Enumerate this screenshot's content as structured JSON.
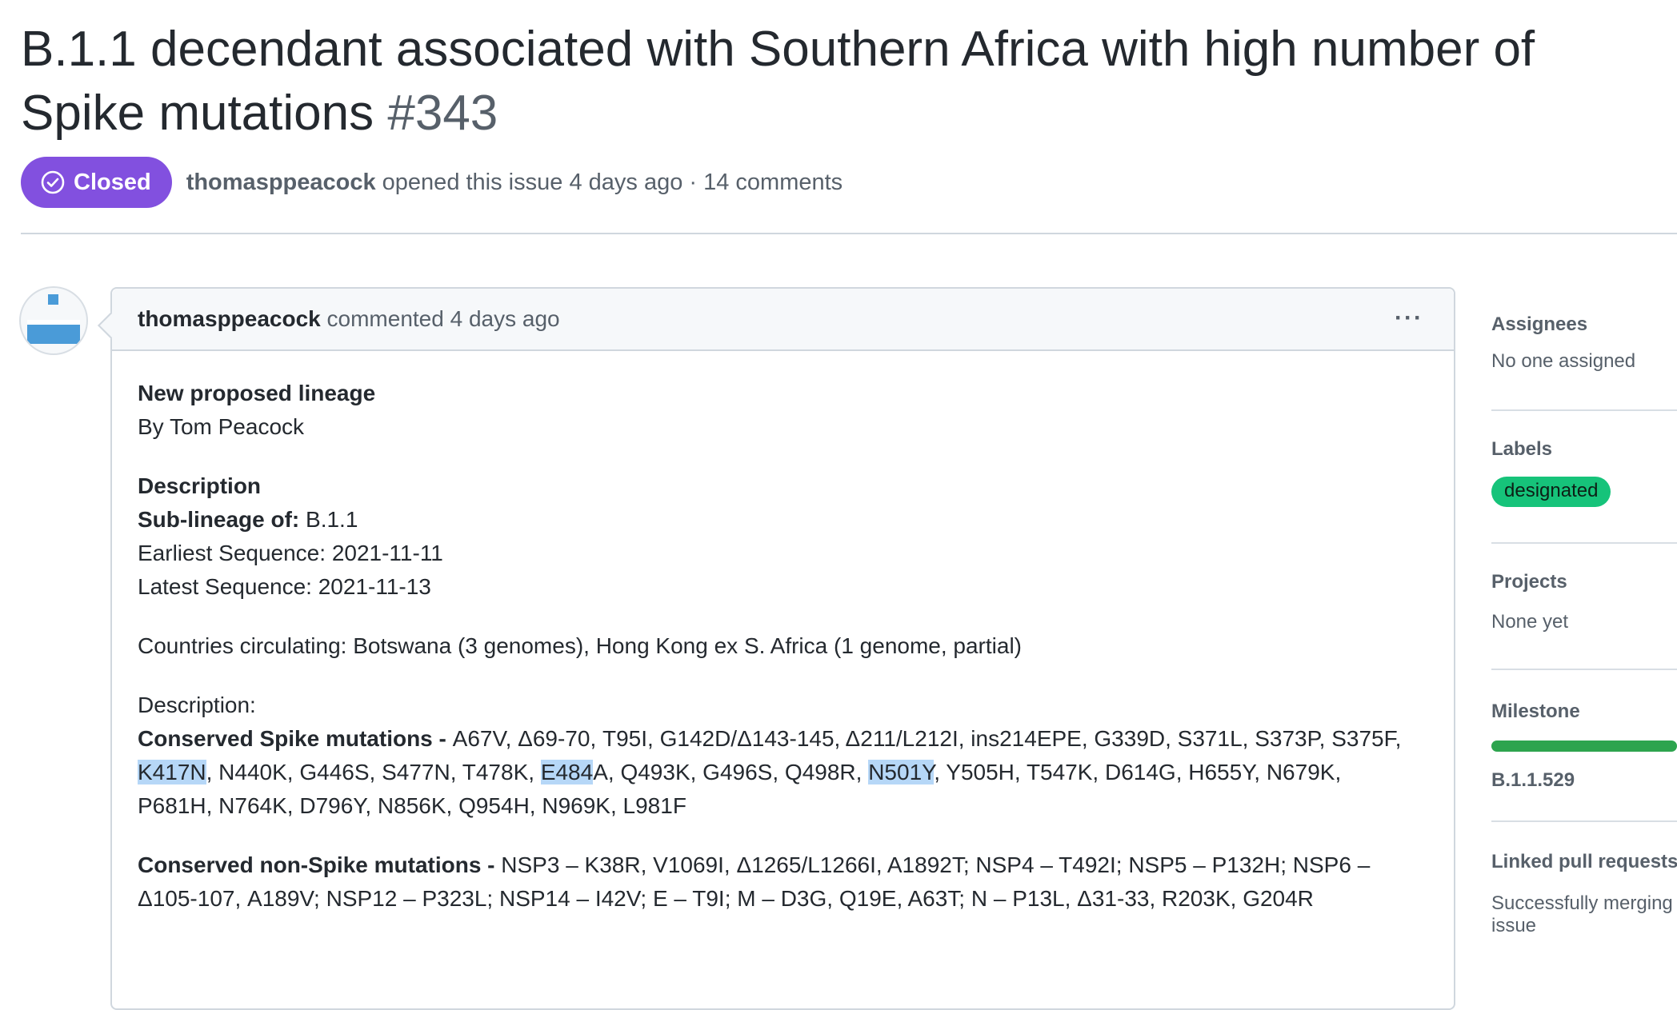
{
  "issue": {
    "title": "B.1.1 decendant associated with Southern Africa with high number of Spike mutations",
    "number": "#343",
    "state": "Closed",
    "author": "thomasppeacock",
    "opened_text": "opened this issue 4 days ago · 14 comments"
  },
  "comment": {
    "author": "thomasppeacock",
    "action_text": "commented 4 days ago",
    "more_label": "···",
    "body": {
      "heading": "New proposed lineage",
      "byline": "By Tom Peacock",
      "desc_heading": "Description",
      "sublineage_label": "Sub-lineage of:",
      "sublineage_value": " B.1.1",
      "earliest": "Earliest Sequence: 2021-11-11",
      "latest": "Latest Sequence: 2021-11-13",
      "countries": "Countries circulating: Botswana (3 genomes), Hong Kong ex S. Africa (1 genome, partial)",
      "desc2": "Description:",
      "spike_label": "Conserved Spike mutations - ",
      "spike_part1": "A67V, Δ69-70, T95I, G142D/Δ143-145, Δ211/L212I, ins214EPE, G339D, S371L, S373P, S375F,",
      "spike_hl1": "K417N",
      "spike_part2": ", N440K, G446S, S477N, T478K, ",
      "spike_hl2": "E484",
      "spike_part3": "A, Q493K, G496S, Q498R, ",
      "spike_hl3": "N501Y",
      "spike_part4": ", Y505H, T547K, D614G, H655Y, N679K,",
      "spike_part5": "P681H, N764K, D796Y, N856K, Q954H, N969K, L981F",
      "nonspike_label": "Conserved non-Spike mutations - ",
      "nonspike_part1": "NSP3 – K38R, V1069I, Δ1265/L1266I, A1892T; NSP4 – T492I; NSP5 – P132H; NSP6 –",
      "nonspike_part2": "Δ105-107, A189V; NSP12 – P323L; NSP14 – I42V; E – T9I; M – D3G, Q19E, A63T; N – P13L, Δ31-33, R203K, G204R"
    }
  },
  "sidebar": {
    "assignees": {
      "title": "Assignees",
      "value": "No one assigned"
    },
    "labels": {
      "title": "Labels",
      "label": "designated",
      "label_color": "#16c37a"
    },
    "projects": {
      "title": "Projects",
      "value": "None yet"
    },
    "milestone": {
      "title": "Milestone",
      "name": "B.1.1.529",
      "progress_percent": 100
    },
    "linked": {
      "title": "Linked pull requests",
      "value": "Successfully merging",
      "value2": "issue"
    }
  },
  "colors": {
    "closed": "#8250df",
    "highlight": "#b6d7f7",
    "progress": "#2da44e"
  }
}
